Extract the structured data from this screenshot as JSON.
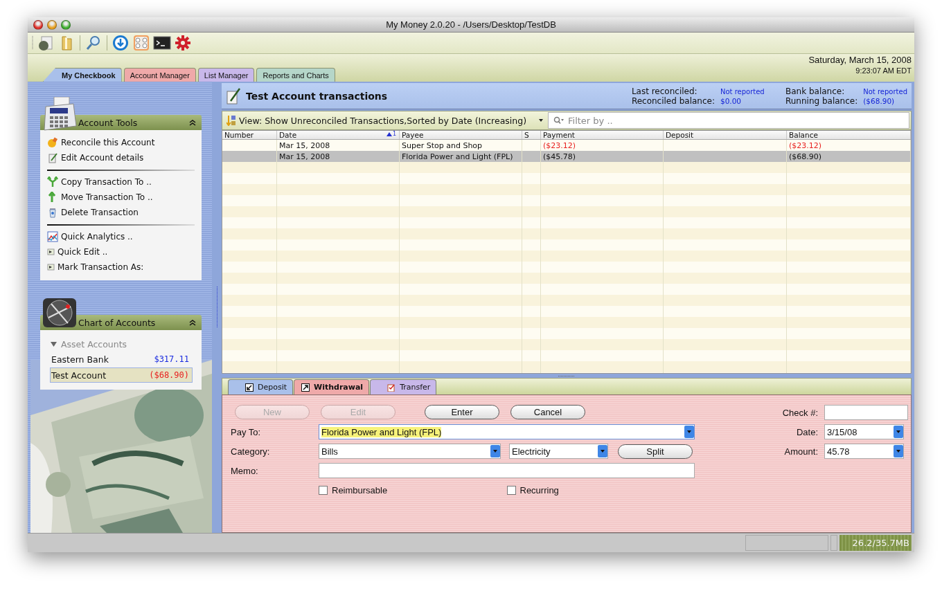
{
  "window": {
    "title": "My Money 2.0.20 - /Users/Desktop/TestDB"
  },
  "main_tabs": [
    {
      "label": "My Checkbook",
      "selected": true,
      "color": "#a9c0ea"
    },
    {
      "label": "Account Manager",
      "selected": false,
      "color": "#efa9a9"
    },
    {
      "label": "List Manager",
      "selected": false,
      "color": "#c8b8ea"
    },
    {
      "label": "Reports and Charts",
      "selected": false,
      "color": "#b5d6c9"
    }
  ],
  "clock": {
    "date": "Saturday, March 15, 2008",
    "time": "9:23:07 AM EDT"
  },
  "account_tools": {
    "title": "Account Tools",
    "groups": [
      {
        "items": [
          {
            "label": "Reconcile this Account"
          },
          {
            "label": "Edit Account details"
          }
        ]
      },
      {
        "items": [
          {
            "label": "Copy Transaction To .."
          },
          {
            "label": "Move Transaction To .."
          },
          {
            "label": "Delete Transaction"
          }
        ]
      },
      {
        "items": [
          {
            "label": "Quick Analytics .."
          },
          {
            "label": "Quick Edit .."
          },
          {
            "label": "Mark Transaction As:"
          }
        ]
      }
    ]
  },
  "chart_of_accounts": {
    "title": "Chart of Accounts",
    "groups": [
      {
        "label": "Asset Accounts",
        "expanded": true,
        "children": [
          {
            "name": "Eastern Bank",
            "amount": "$317.11",
            "negative": false,
            "selected": false
          },
          {
            "name": "Test Account",
            "amount": "($68.90)",
            "negative": true,
            "selected": true
          }
        ]
      }
    ]
  },
  "header": {
    "title": "Test Account transactions",
    "stats": [
      {
        "label": "Last reconciled:",
        "value": "Not reported"
      },
      {
        "label": "Bank balance:",
        "value": "Not reported"
      },
      {
        "label": "Reconciled balance:",
        "value": "$0.00"
      },
      {
        "label": "Running balance:",
        "value": "($68.90)"
      }
    ]
  },
  "view": {
    "label": "View: Show Unreconciled Transactions,Sorted by Date (Increasing)"
  },
  "filter": {
    "placeholder": "Filter by .."
  },
  "table": {
    "columns": [
      {
        "label": "Number"
      },
      {
        "label": "Date",
        "sort": "1"
      },
      {
        "label": "Payee"
      },
      {
        "label": "S"
      },
      {
        "label": "Payment"
      },
      {
        "label": "Deposit"
      },
      {
        "label": "Balance"
      }
    ],
    "rows": [
      {
        "date": "Mar 15, 2008",
        "payee": "Super Stop and Shop",
        "payment": "($23.12)",
        "balance": "($23.12)",
        "selected": false
      },
      {
        "date": "Mar 15, 2008",
        "payee": "Florida Power and Light (FPL)",
        "payment": "($45.78)",
        "balance": "($68.90)",
        "selected": true
      }
    ]
  },
  "form": {
    "tabs": [
      {
        "label": "Deposit",
        "selected": false,
        "color": "#a9c0ea"
      },
      {
        "label": "Withdrawal",
        "selected": true,
        "color": "#efa9a9"
      },
      {
        "label": "Transfer",
        "selected": false,
        "color": "#c8b8ea"
      }
    ],
    "buttons": [
      {
        "label": "New",
        "disabled": true
      },
      {
        "label": "Edit",
        "disabled": true
      },
      {
        "label": "Enter",
        "disabled": false
      },
      {
        "label": "Cancel",
        "disabled": false
      }
    ],
    "pay_to": {
      "label": "Pay To:",
      "value": "Florida Power and Light (FPL)",
      "text_selected": true
    },
    "category": {
      "label": "Category:",
      "value": "Bills"
    },
    "subcategory": {
      "value": "Electricity"
    },
    "split": {
      "label": "Split"
    },
    "memo": {
      "label": "Memo:"
    },
    "check": {
      "label": "Check #:"
    },
    "date": {
      "label": "Date:",
      "value": "3/15/08"
    },
    "amount": {
      "label": "Amount:",
      "value": "45.78"
    },
    "checkboxes": [
      {
        "label": "Reimbursable",
        "checked": false
      },
      {
        "label": "Recurring",
        "checked": false
      }
    ]
  },
  "status_bar": {
    "memory": "26.2/35.7MB"
  }
}
